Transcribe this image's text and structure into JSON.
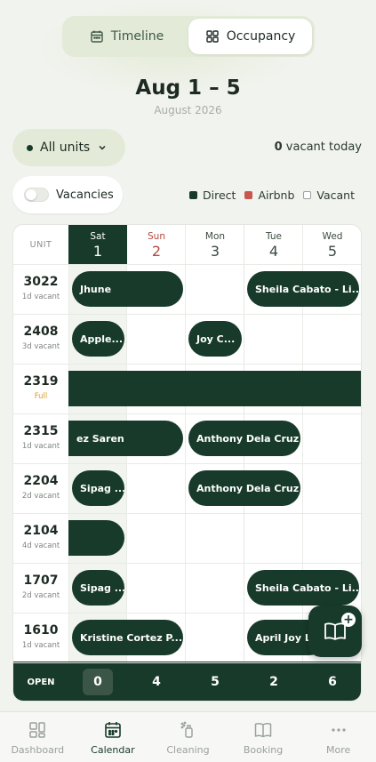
{
  "segmented": {
    "timeline": {
      "label": "Timeline",
      "icon": "calendar-icon"
    },
    "occupancy": {
      "label": "Occupancy",
      "icon": "grid-icon"
    }
  },
  "header": {
    "title": "Aug 1 – 5",
    "subtitle": "August 2026"
  },
  "filters": {
    "units_label": "All units",
    "vacant_count": "0",
    "vacant_suffix": " vacant today",
    "vacancies_label": "Vacancies"
  },
  "legend": [
    {
      "label": "Direct",
      "color": "#173a2a"
    },
    {
      "label": "Airbnb",
      "color": "#c8574f"
    },
    {
      "label": "Vacant",
      "color": "#ffffff"
    }
  ],
  "grid": {
    "unit_header": "UNIT",
    "days": [
      {
        "name": "Sat",
        "date": "1",
        "style": "today"
      },
      {
        "name": "Sun",
        "date": "2",
        "style": "weekend"
      },
      {
        "name": "Mon",
        "date": "3",
        "style": "normal"
      },
      {
        "name": "Tue",
        "date": "4",
        "style": "normal"
      },
      {
        "name": "Wed",
        "date": "5",
        "style": "normal"
      }
    ],
    "units": [
      {
        "number": "3022",
        "count": "1",
        "status": "d vacant",
        "full": false
      },
      {
        "number": "2408",
        "count": "3",
        "status": "d vacant",
        "full": false
      },
      {
        "number": "2319",
        "count": "",
        "status": "Full",
        "full": true
      },
      {
        "number": "2315",
        "count": "1",
        "status": "d vacant",
        "full": false
      },
      {
        "number": "2204",
        "count": "2",
        "status": "d vacant",
        "full": false
      },
      {
        "number": "2104",
        "count": "4",
        "status": "d vacant",
        "full": false
      },
      {
        "number": "1707",
        "count": "2",
        "status": "d vacant",
        "full": false
      },
      {
        "number": "1610",
        "count": "1",
        "status": "d vacant",
        "full": false
      }
    ],
    "bookings": [
      {
        "row": 0,
        "label": "Jhune"
      },
      {
        "row": 0,
        "label": "Sheila Cabato - Li..."
      },
      {
        "row": 1,
        "label": "Apple..."
      },
      {
        "row": 1,
        "label": "Joy C..."
      },
      {
        "row": 2,
        "label": ""
      },
      {
        "row": 3,
        "label": "ez Saren"
      },
      {
        "row": 3,
        "label": "Anthony Dela Cruz"
      },
      {
        "row": 4,
        "label": "Sipag ..."
      },
      {
        "row": 4,
        "label": "Anthony Dela Cruz"
      },
      {
        "row": 5,
        "label": ""
      },
      {
        "row": 6,
        "label": "Sipag ..."
      },
      {
        "row": 6,
        "label": "Sheila Cabato - Li..."
      },
      {
        "row": 7,
        "label": "Kristine Cortez P..."
      },
      {
        "row": 7,
        "label": "April Joy L..."
      }
    ],
    "open_label": "OPEN",
    "open_values": [
      "0",
      "4",
      "5",
      "2",
      "6"
    ]
  },
  "fab": {
    "icon": "book-plus-icon",
    "plus": "+"
  },
  "tabs": [
    {
      "label": "Dashboard",
      "icon": "dashboard-icon",
      "active": false
    },
    {
      "label": "Calendar",
      "icon": "calendar-icon",
      "active": true
    },
    {
      "label": "Cleaning",
      "icon": "cleaning-icon",
      "active": false
    },
    {
      "label": "Booking",
      "icon": "book-icon",
      "active": false
    },
    {
      "label": "More",
      "icon": "more-icon",
      "active": false
    }
  ]
}
